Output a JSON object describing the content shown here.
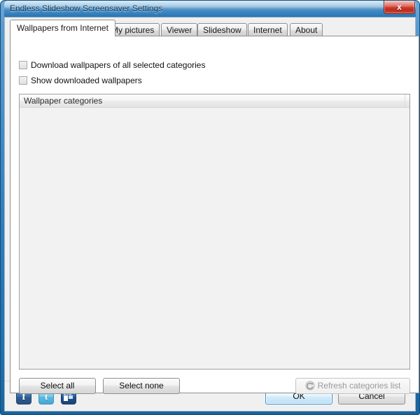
{
  "window": {
    "title": "Endless Slideshow Screensaver Settings",
    "close_label": "x",
    "close_icon": "close-icon",
    "frame_color": "#2776b6",
    "accent_color": "#3c93d0"
  },
  "tabs": [
    {
      "label": "Wallpapers from Internet",
      "active": true
    },
    {
      "label": "My pictures",
      "active": false
    },
    {
      "label": "Viewer",
      "active": false
    },
    {
      "label": "Slideshow",
      "active": false
    },
    {
      "label": "Internet",
      "active": false
    },
    {
      "label": "About",
      "active": false
    }
  ],
  "panel": {
    "checkboxes": [
      {
        "label": "Download wallpapers of all selected categories",
        "checked": false
      },
      {
        "label": "Show downloaded wallpapers",
        "checked": false
      }
    ],
    "list": {
      "columns": [
        "Wallpaper categories",
        ""
      ],
      "rows": []
    },
    "buttons": {
      "select_all": "Select all",
      "select_none": "Select none",
      "refresh": "Refresh categories list",
      "refresh_icon": "refresh-icon",
      "refresh_disabled": true
    }
  },
  "bottom_bar": {
    "social": [
      {
        "name": "facebook-icon",
        "glyph": "f"
      },
      {
        "name": "twitter-icon",
        "glyph": "t"
      },
      {
        "name": "myspace-icon",
        "glyph": ""
      }
    ],
    "ok_label": "OK",
    "cancel_label": "Cancel"
  }
}
